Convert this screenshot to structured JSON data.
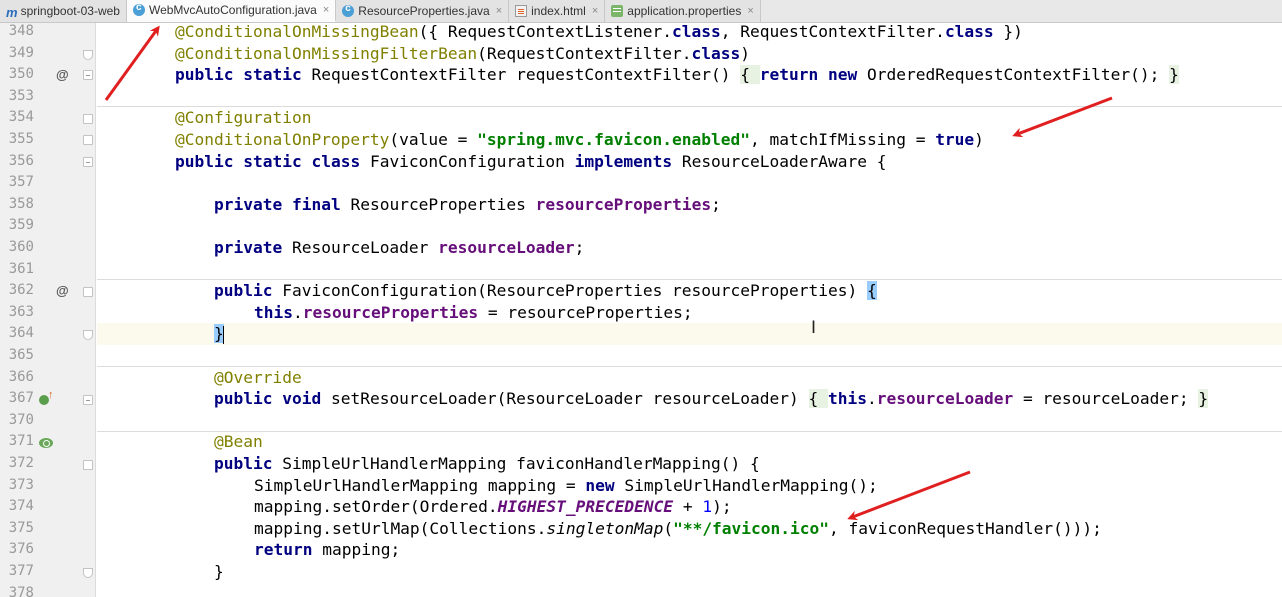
{
  "tabs": [
    {
      "label": "springboot-03-web",
      "icon": "module-icon",
      "active": false,
      "closable": false
    },
    {
      "label": "WebMvcAutoConfiguration.java",
      "icon": "java-class-icon",
      "active": true,
      "closable": true
    },
    {
      "label": "ResourceProperties.java",
      "icon": "java-class-icon",
      "active": false,
      "closable": true
    },
    {
      "label": "index.html",
      "icon": "html-file-icon",
      "active": false,
      "closable": true
    },
    {
      "label": "application.properties",
      "icon": "properties-file-icon",
      "active": false,
      "closable": true
    }
  ],
  "tab_close_glyph": "×",
  "line_numbers": [
    "348",
    "349",
    "350",
    "353",
    "354",
    "355",
    "356",
    "357",
    "358",
    "359",
    "360",
    "361",
    "362",
    "363",
    "364",
    "365",
    "366",
    "367",
    "370",
    "371",
    "372",
    "373",
    "374",
    "375",
    "376",
    "377",
    "378"
  ],
  "gutter_marks": {
    "override_marker": "@"
  },
  "code": {
    "l348": {
      "a": "@ConditionalOnMissingBean",
      "b": "({ RequestContextListener.",
      "c": "class",
      "d": ", RequestContextFilter.",
      "e": "class",
      "f": " })"
    },
    "l349": {
      "a": "@ConditionalOnMissingFilterBean",
      "b": "(RequestContextFilter.",
      "c": "class",
      "d": ")"
    },
    "l350": {
      "a": "public",
      "b": " ",
      "c": "static",
      "d": " RequestContextFilter requestContextFilter() ",
      "e": "{ ",
      "f": "return",
      "g": " ",
      "h": "new",
      "i": " OrderedRequestContextFilter(); ",
      "j": "}"
    },
    "l354": {
      "a": "@Configuration"
    },
    "l355": {
      "a": "@ConditionalOnProperty",
      "b": "(value = ",
      "c": "\"spring.mvc.favicon.enabled\"",
      "d": ", matchIfMissing = ",
      "e": "true",
      "f": ")"
    },
    "l356": {
      "a": "public",
      "b": " ",
      "c": "static",
      "d": " ",
      "e": "class",
      "f": " FaviconConfiguration ",
      "g": "implements",
      "h": " ResourceLoaderAware {"
    },
    "l358": {
      "a": "private",
      "b": " ",
      "c": "final",
      "d": " ResourceProperties ",
      "e": "resourceProperties",
      "f": ";"
    },
    "l360": {
      "a": "private",
      "b": " ResourceLoader ",
      "c": "resourceLoader",
      "d": ";"
    },
    "l362": {
      "a": "public",
      "b": " FaviconConfiguration(ResourceProperties resourceProperties) ",
      "c": "{"
    },
    "l363": {
      "a": "this",
      "b": ".",
      "c": "resourceProperties",
      "d": " = resourceProperties;"
    },
    "l364": {
      "a": "}"
    },
    "l366": {
      "a": "@Override"
    },
    "l367": {
      "a": "public",
      "b": " ",
      "c": "void",
      "d": " setResourceLoader(ResourceLoader resourceLoader) ",
      "e": "{ ",
      "f": "this",
      "g": ".",
      "h": "resourceLoader",
      "i": " = resourceLoader; ",
      "j": "}"
    },
    "l371": {
      "a": "@Bean"
    },
    "l372": {
      "a": "public",
      "b": " SimpleUrlHandlerMapping faviconHandlerMapping() {"
    },
    "l373": {
      "a": "SimpleUrlHandlerMapping mapping = ",
      "b": "new",
      "c": " SimpleUrlHandlerMapping();"
    },
    "l374": {
      "a": "mapping.setOrder(Ordered.",
      "b": "HIGHEST_PRECEDENCE",
      "c": " + ",
      "d": "1",
      "e": ");"
    },
    "l375": {
      "a": "mapping.setUrlMap(Collections.",
      "b": "singletonMap",
      "c": "(",
      "d": "\"**/favicon.ico\"",
      "e": ", faviconRequestHandler()));"
    },
    "l376": {
      "a": "return",
      "b": " mapping;"
    },
    "l377": {
      "a": "}"
    }
  },
  "colors": {
    "annotation": "#808000",
    "keyword": "#000080",
    "string": "#008000",
    "field": "#660e7a",
    "number": "#0000ff",
    "arrow": "#e02020",
    "current_line": "#fcfaed"
  }
}
